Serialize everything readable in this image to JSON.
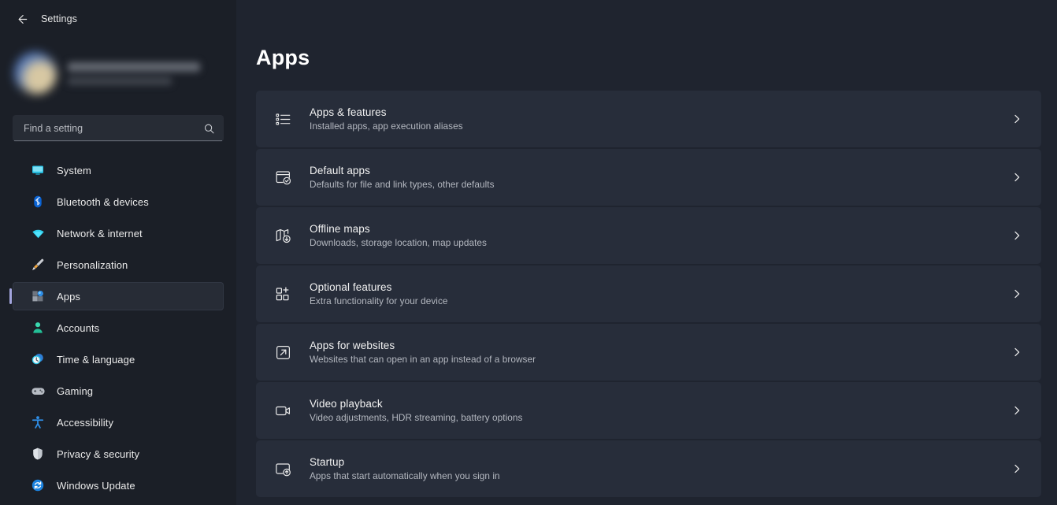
{
  "window": {
    "title": "Settings",
    "back_icon": "back-arrow-icon"
  },
  "sidebar": {
    "profile": {
      "redacted": true,
      "avatar_icon": "user-avatar"
    },
    "search": {
      "placeholder": "Find a setting",
      "value": "",
      "icon": "search-icon"
    },
    "items": [
      {
        "label": "System",
        "icon": "monitor-icon",
        "selected": false
      },
      {
        "label": "Bluetooth & devices",
        "icon": "bluetooth-icon",
        "selected": false
      },
      {
        "label": "Network & internet",
        "icon": "wifi-icon",
        "selected": false
      },
      {
        "label": "Personalization",
        "icon": "paintbrush-icon",
        "selected": false
      },
      {
        "label": "Apps",
        "icon": "apps-grid-icon",
        "selected": true
      },
      {
        "label": "Accounts",
        "icon": "person-icon",
        "selected": false
      },
      {
        "label": "Time & language",
        "icon": "clock-icon",
        "selected": false
      },
      {
        "label": "Gaming",
        "icon": "gamepad-icon",
        "selected": false
      },
      {
        "label": "Accessibility",
        "icon": "accessibility-icon",
        "selected": false
      },
      {
        "label": "Privacy & security",
        "icon": "shield-icon",
        "selected": false
      },
      {
        "label": "Windows Update",
        "icon": "refresh-icon",
        "selected": false
      }
    ]
  },
  "main": {
    "title": "Apps",
    "chevron_icon": "chevron-right-icon",
    "cards": [
      {
        "title": "Apps & features",
        "subtitle": "Installed apps, app execution aliases",
        "icon": "list-icon"
      },
      {
        "title": "Default apps",
        "subtitle": "Defaults for file and link types, other defaults",
        "icon": "window-check-icon"
      },
      {
        "title": "Offline maps",
        "subtitle": "Downloads, storage location, map updates",
        "icon": "map-download-icon"
      },
      {
        "title": "Optional features",
        "subtitle": "Extra functionality for your device",
        "icon": "grid-plus-icon"
      },
      {
        "title": "Apps for websites",
        "subtitle": "Websites that can open in an app instead of a browser",
        "icon": "external-link-icon"
      },
      {
        "title": "Video playback",
        "subtitle": "Video adjustments, HDR streaming, battery options",
        "icon": "video-camera-icon"
      },
      {
        "title": "Startup",
        "subtitle": "Apps that start automatically when you sign in",
        "icon": "startup-icon"
      }
    ]
  },
  "colors": {
    "page_background": "#1f242f",
    "sidebar_background": "#1b1f27",
    "card_background": "#272d3a",
    "selected_accent": "#a3a5dd",
    "title_text": "#ffffff",
    "subtitle_text": "#b4b8c0"
  }
}
